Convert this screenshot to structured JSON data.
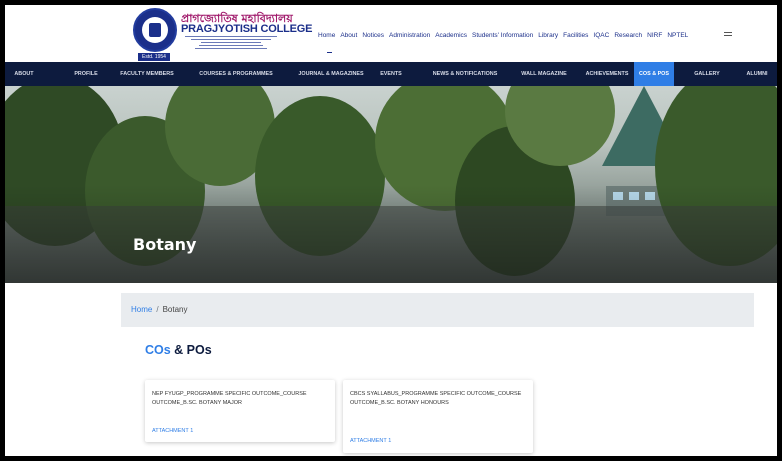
{
  "header": {
    "logo_bengali": "প্ৰাগজ্যোতিষ মহাবিদ্যালয়",
    "logo_english": "PRAGJYOTISH COLLEGE",
    "logo_established": "Estd. 1954",
    "top_nav": [
      "Home",
      "About",
      "Notices",
      "Administration",
      "Academics",
      "Students' Information",
      "Library",
      "Facilities",
      "IQAC",
      "Research",
      "NIRF",
      "NPTEL"
    ]
  },
  "main_nav": {
    "items": [
      "ABOUT",
      "PROFILE",
      "FACULTY MEMBERS",
      "COURSES & PROGRAMMES",
      "JOURNAL & MAGAZINES",
      "EVENTS",
      "NEWS & NOTIFICATIONS",
      "WALL MAGAZINE",
      "ACHIEVEMENTS",
      "COs & POs",
      "GALLERY",
      "ALUMNI"
    ],
    "active": "COs & POs"
  },
  "hero": {
    "title": "Botany"
  },
  "breadcrumb": {
    "home": "Home",
    "separator": "/",
    "current": "Botany"
  },
  "section": {
    "title_accent": "COs",
    "title_rest": " & POs"
  },
  "cards": [
    {
      "title": "NEP FYUGP_PROGRAMME SPECIFIC OUTCOME_COURSE OUTCOME_B.Sc. Botany Major",
      "attachment": "ATTACHMENT 1"
    },
    {
      "title": "CBCS Syallabus_PROGRAMME SPECIFIC OUTCOME_COURSE OUTCOME_B.SC. BOTANY HONOURS",
      "attachment": "ATTACHMENT 1"
    }
  ],
  "colors": {
    "navy": "#0d1b3e",
    "accent": "#2f7ee6",
    "breadcrumb_bg": "#e9ecef"
  },
  "icons": {
    "menu": "hamburger-icon",
    "logo": "college-emblem-icon"
  }
}
